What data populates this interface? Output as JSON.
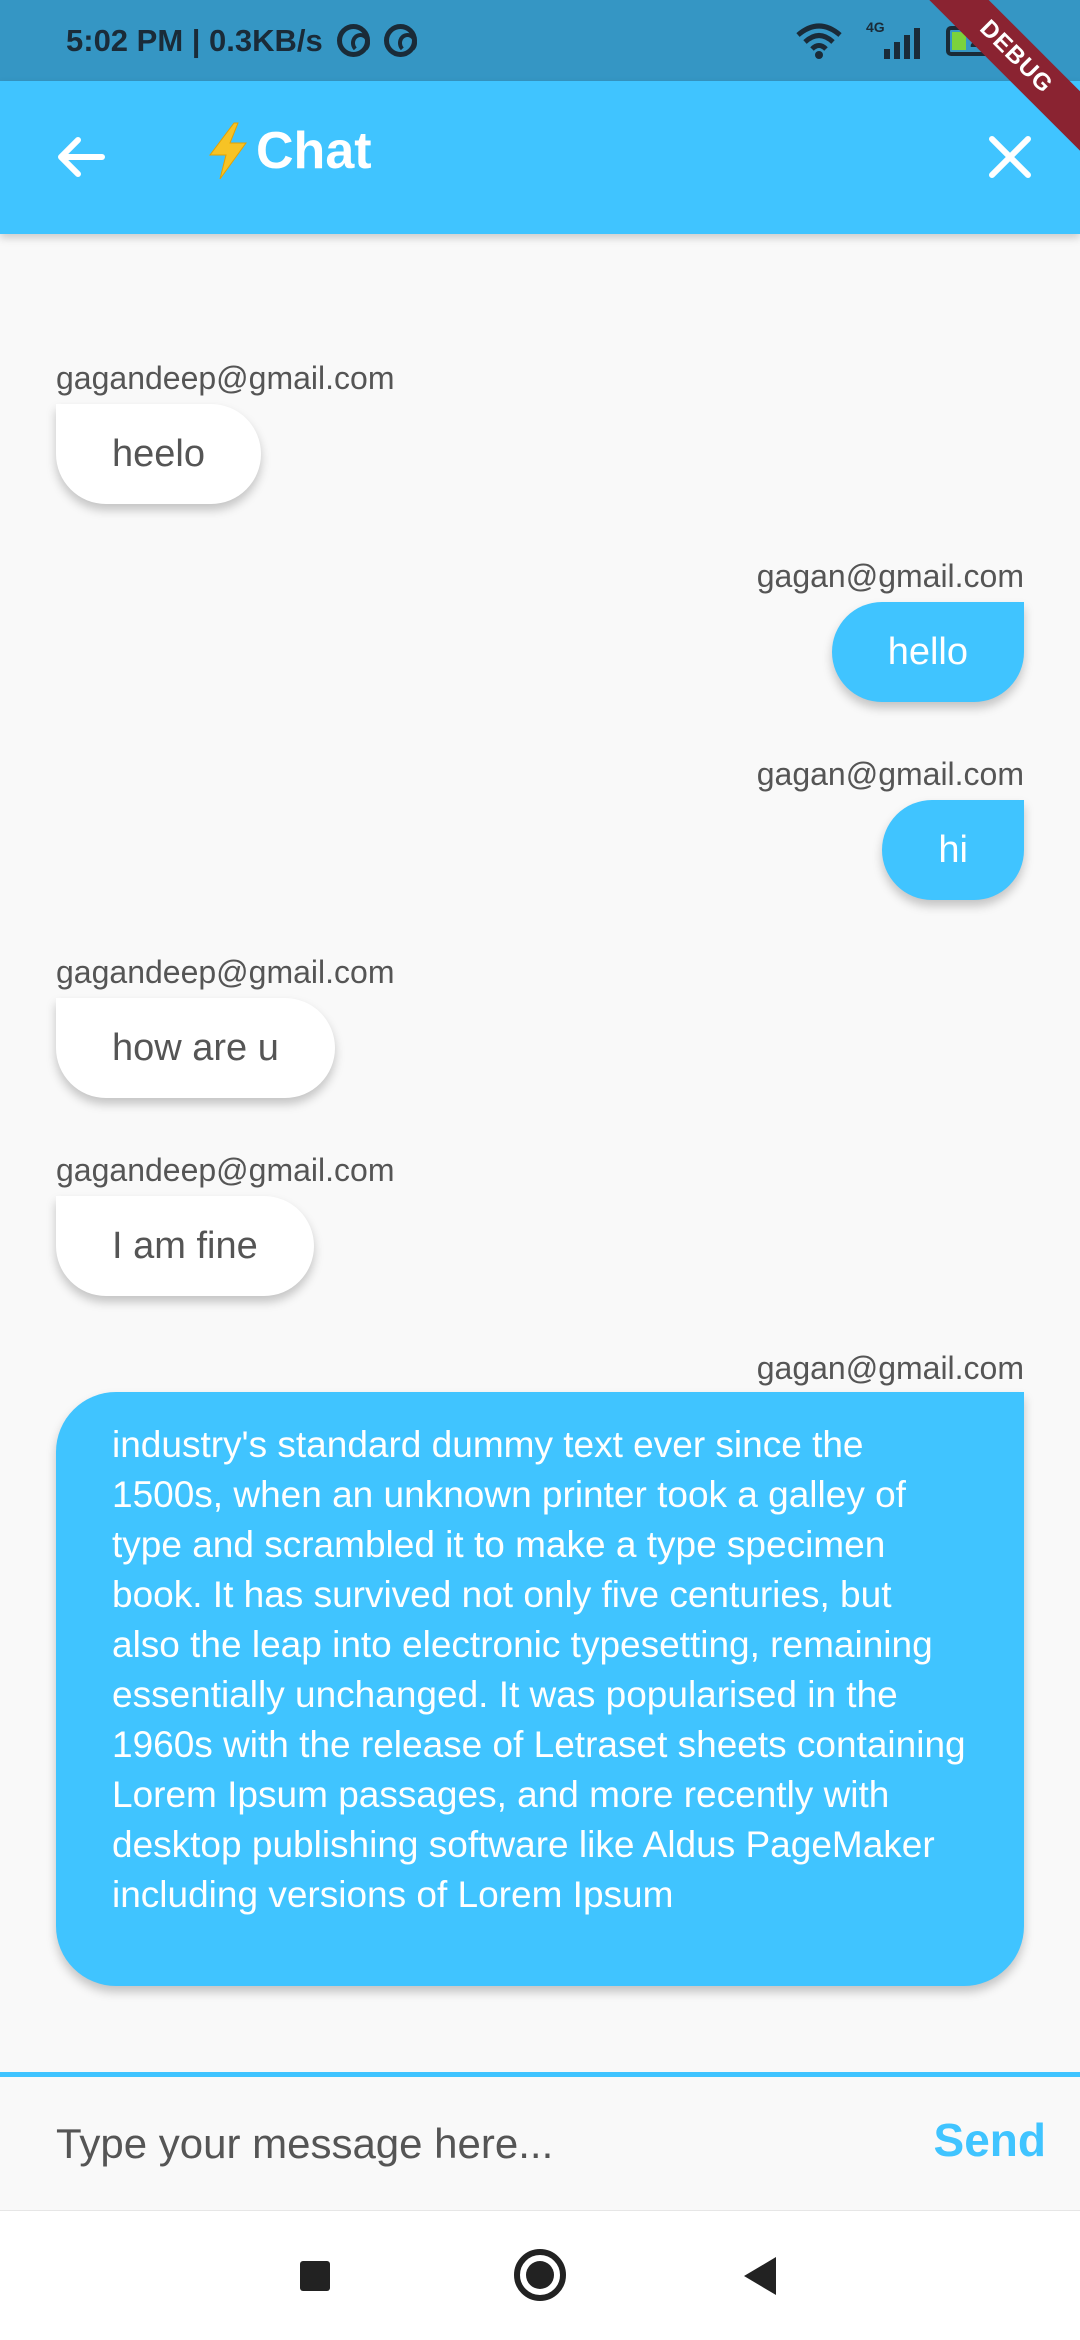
{
  "status_bar": {
    "time_speed": "5:02 PM | 0.3KB/s",
    "network_label": "4G",
    "battery_level": "21",
    "debug_banner": "DEBUG"
  },
  "app_bar": {
    "title": "Chat",
    "title_icon": "lightning-bolt-icon",
    "back_icon": "arrow-back-icon",
    "close_icon": "close-icon",
    "color": "#40c4ff"
  },
  "messages": [
    {
      "sender": "gagandeep@gmail.com",
      "text": "heelo",
      "direction": "incoming"
    },
    {
      "sender": "gagan@gmail.com",
      "text": "hello",
      "direction": "outgoing"
    },
    {
      "sender": "gagan@gmail.com",
      "text": "hi",
      "direction": "outgoing"
    },
    {
      "sender": "gagandeep@gmail.com",
      "text": "how are u",
      "direction": "incoming"
    },
    {
      "sender": "gagandeep@gmail.com",
      "text": "I am fine",
      "direction": "incoming"
    },
    {
      "sender": "gagan@gmail.com",
      "text": "industry's standard dummy text ever since the 1500s, when an unknown printer took a galley of type and scrambled it to make a type specimen book. It has survived not only five centuries, but also the leap into electronic typesetting, remaining essentially unchanged. It was popularised in the 1960s with the release of Letraset sheets containing Lorem Ipsum passages, and more recently with desktop publishing software like Aldus PageMaker including versions of Lorem Ipsum",
      "direction": "outgoing"
    }
  ],
  "composer": {
    "placeholder": "Type your message here...",
    "value": "",
    "send_label": "Send"
  },
  "nav_bar": {
    "recent_icon": "square-recents-icon",
    "home_icon": "circle-home-icon",
    "back_icon": "triangle-back-icon"
  }
}
